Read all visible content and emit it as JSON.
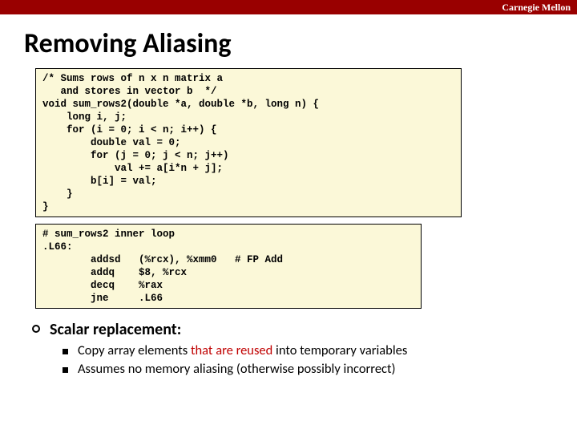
{
  "brand": "Carnegie Mellon",
  "title": "Removing Aliasing",
  "code_c": "/* Sums rows of n x n matrix a\n   and stores in vector b  */\nvoid sum_rows2(double *a, double *b, long n) {\n    long i, j;\n    for (i = 0; i < n; i++) {\n        double val = 0;\n        for (j = 0; j < n; j++)\n            val += a[i*n + j];\n        b[i] = val;\n    }\n}",
  "code_asm": "# sum_rows2 inner loop\n.L66:\n        addsd   (%rcx), %xmm0   # FP Add\n        addq    $8, %rcx\n        decq    %rax\n        jne     .L66",
  "bullet1": "Scalar replacement:",
  "b2a_pre": "Copy array elements ",
  "b2a_hl": "that are reused",
  "b2a_post": " into temporary variables",
  "b2b": "Assumes no memory aliasing (otherwise possibly incorrect)"
}
